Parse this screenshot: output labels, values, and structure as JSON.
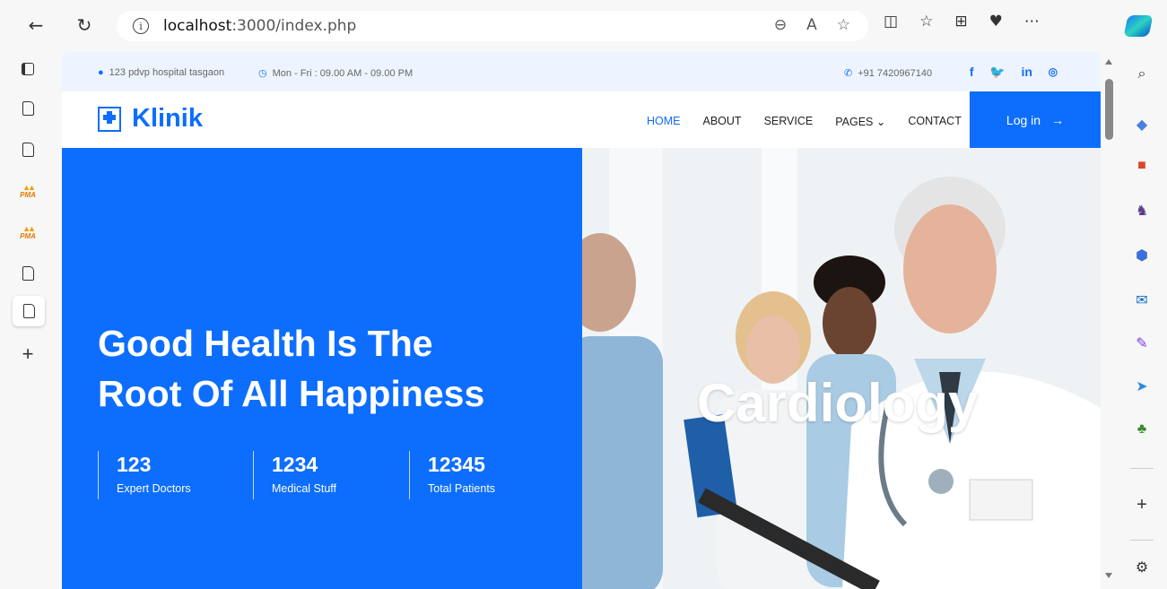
{
  "browser": {
    "url_host": "localhost",
    "url_path": ":3000/index.php"
  },
  "topinfo": {
    "address": "123 pdvp hospital tasgaon",
    "hours": "Mon - Fri : 09.00 AM - 09.00 PM",
    "phone": "+91 7420967140",
    "social": [
      "f",
      "in"
    ]
  },
  "nav": {
    "brand": "Klinik",
    "items": [
      {
        "label": "HOME",
        "active": true
      },
      {
        "label": "ABOUT"
      },
      {
        "label": "SERVICE"
      },
      {
        "label": "PAGES"
      },
      {
        "label": "CONTACT"
      }
    ],
    "login": "Log in"
  },
  "hero": {
    "title_line1": "Good Health Is The",
    "title_line2": "Root Of All Happiness",
    "overlay": "Cardiology",
    "stats": [
      {
        "num": "123",
        "label": "Expert Doctors"
      },
      {
        "num": "1234",
        "label": "Medical Stuff"
      },
      {
        "num": "12345",
        "label": "Total Patients"
      }
    ]
  },
  "colors": {
    "brand": "#0d6efd"
  }
}
